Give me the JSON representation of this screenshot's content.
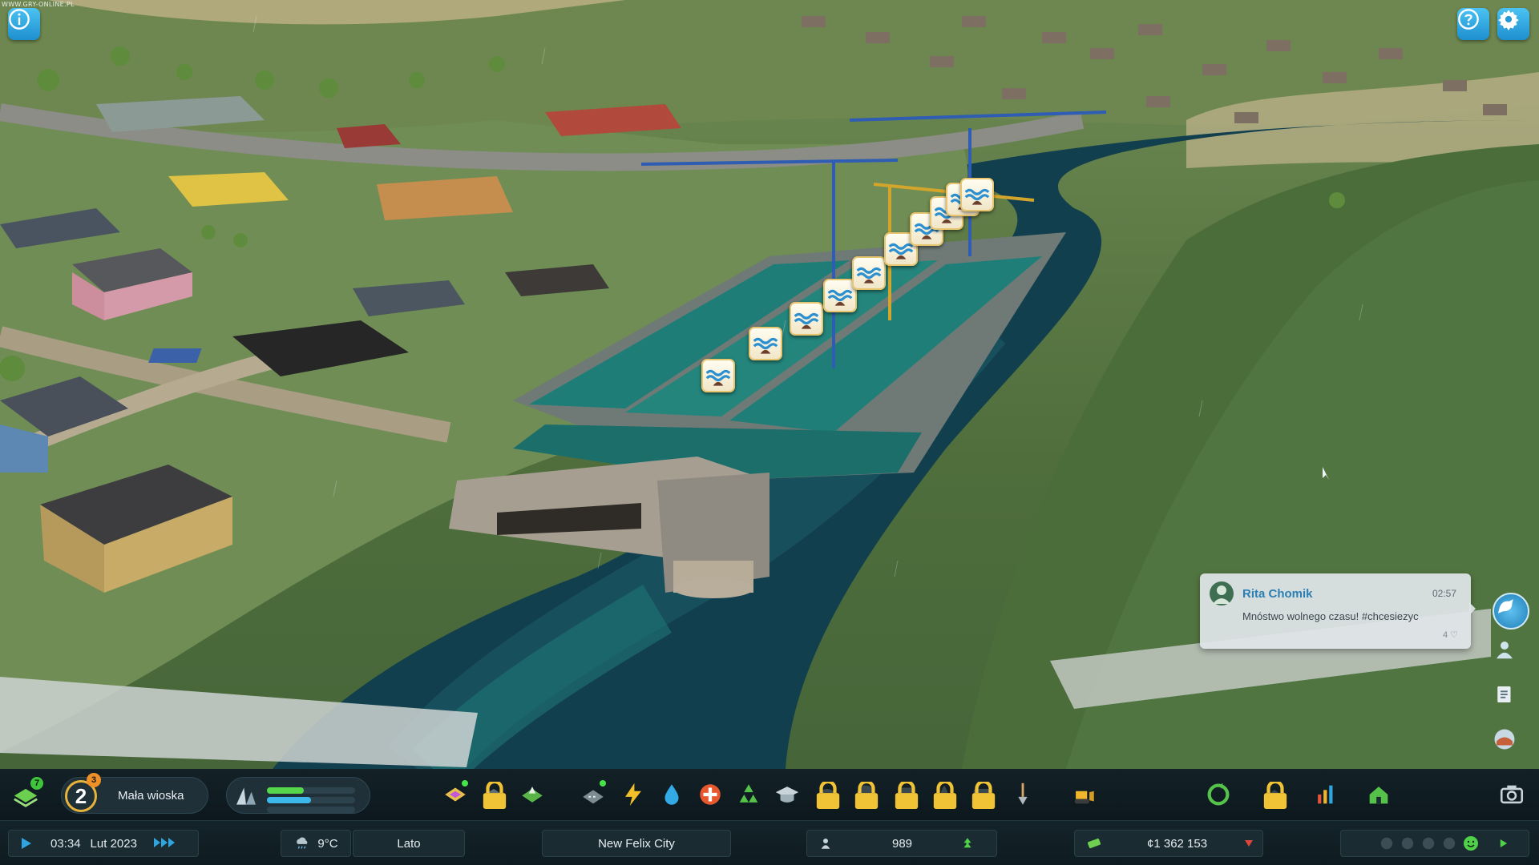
{
  "watermark": "WWW.GRY-ONLINE.PL",
  "top_buttons": {
    "info": "info-icon",
    "help": "help-icon",
    "settings": "gear-icon"
  },
  "chirp": {
    "author": "Rita Chomik",
    "time": "02:57",
    "message": "Mnóstwo wolnego czasu! #chcesiezyc",
    "likes": "4"
  },
  "toolbar": {
    "unlocks_badge": "7",
    "milestone_number": "2",
    "milestone_badge": "3",
    "milestone_label": "Mała wioska",
    "demand": {
      "residential": 0.4,
      "commercial": 0.5,
      "industrial": 0.0
    },
    "tools": [
      "zoning-icon",
      "areas-icon",
      "landscaping-icon",
      "roads-icon",
      "electricity-icon",
      "water-icon",
      "healthcare-icon",
      "garbage-icon",
      "education-icon",
      "police-icon",
      "fire-icon",
      "transport-icon",
      "parks-icon",
      "communications-icon",
      "shovel-icon",
      "bulldozer-icon",
      "recycle-icon",
      "signature-icon",
      "statistics-icon",
      "house-icon",
      "camera-icon"
    ]
  },
  "status": {
    "time": "03:34",
    "date": "Lut 2023",
    "temperature": "9°C",
    "season": "Lato",
    "city_name": "New Felix City",
    "population": "989",
    "money": "¢1 362 153"
  },
  "colors": {
    "accent": "#2fa4de",
    "residential_bar": "#56d64a",
    "commercial_bar": "#3cb8ea",
    "money_down": "#e0453a",
    "happy": "#4fd14a"
  }
}
